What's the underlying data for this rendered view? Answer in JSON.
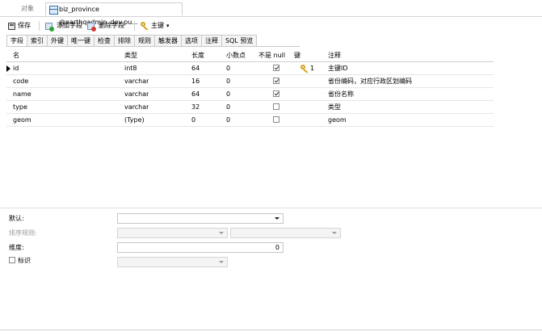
{
  "doc_tabs": {
    "inactive": "对象",
    "active": "biz_province @earthqadmin_dev.pu..."
  },
  "toolbar": {
    "save": "保存",
    "add_field": "添加字段",
    "delete_field": "删除字段",
    "primary_key": "主键",
    "primary_key_menu": "▾"
  },
  "editor_tabs": [
    "字段",
    "索引",
    "外键",
    "唯一键",
    "检查",
    "排除",
    "规则",
    "触发器",
    "选项",
    "注释",
    "SQL 预览"
  ],
  "grid": {
    "headers": {
      "name": "名",
      "type": "类型",
      "length": "长度",
      "decimals": "小数点",
      "not_null": "不是 null",
      "key": "键",
      "comment": "注释"
    },
    "rows": [
      {
        "name": "id",
        "type": "int8",
        "length": "64",
        "decimals": "0",
        "not_null": true,
        "key": "1",
        "is_pk": true,
        "comment": "主键ID",
        "current": true
      },
      {
        "name": "code",
        "type": "varchar",
        "length": "16",
        "decimals": "0",
        "not_null": true,
        "key": "",
        "is_pk": false,
        "comment": "省份编码，对应行政区划编码",
        "current": false
      },
      {
        "name": "name",
        "type": "varchar",
        "length": "64",
        "decimals": "0",
        "not_null": true,
        "key": "",
        "is_pk": false,
        "comment": "省份名称",
        "current": false
      },
      {
        "name": "type",
        "type": "varchar",
        "length": "32",
        "decimals": "0",
        "not_null": false,
        "key": "",
        "is_pk": false,
        "comment": "类型",
        "current": false
      },
      {
        "name": "geom",
        "type": "(Type)",
        "length": "0",
        "decimals": "0",
        "not_null": false,
        "key": "",
        "is_pk": false,
        "comment": "geom",
        "current": false
      }
    ]
  },
  "properties": {
    "default_label": "默认:",
    "collation_label": "排序规则:",
    "dimension_label": "维度:",
    "dimension_value": "0",
    "identity_label": "标识"
  }
}
